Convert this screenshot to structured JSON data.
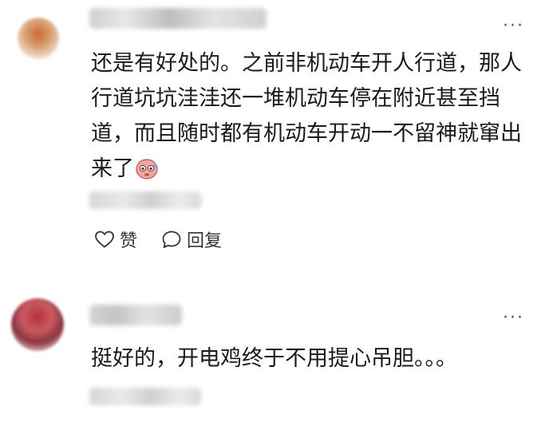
{
  "comments": [
    {
      "text": "还是有好处的。之前非机动车开人行道，那人行道坑坑洼洼还一堆机动车停在附近甚至挡道，而且随时都有机动车开动一不留神就窜出来了",
      "emoji_icon": "sweating-face-emoji-icon",
      "more_label": "···",
      "like_label": "赞",
      "reply_label": "回复"
    },
    {
      "text": "挺好的，开电鸡终于不用提心吊胆。。。",
      "more_label": "···"
    }
  ]
}
